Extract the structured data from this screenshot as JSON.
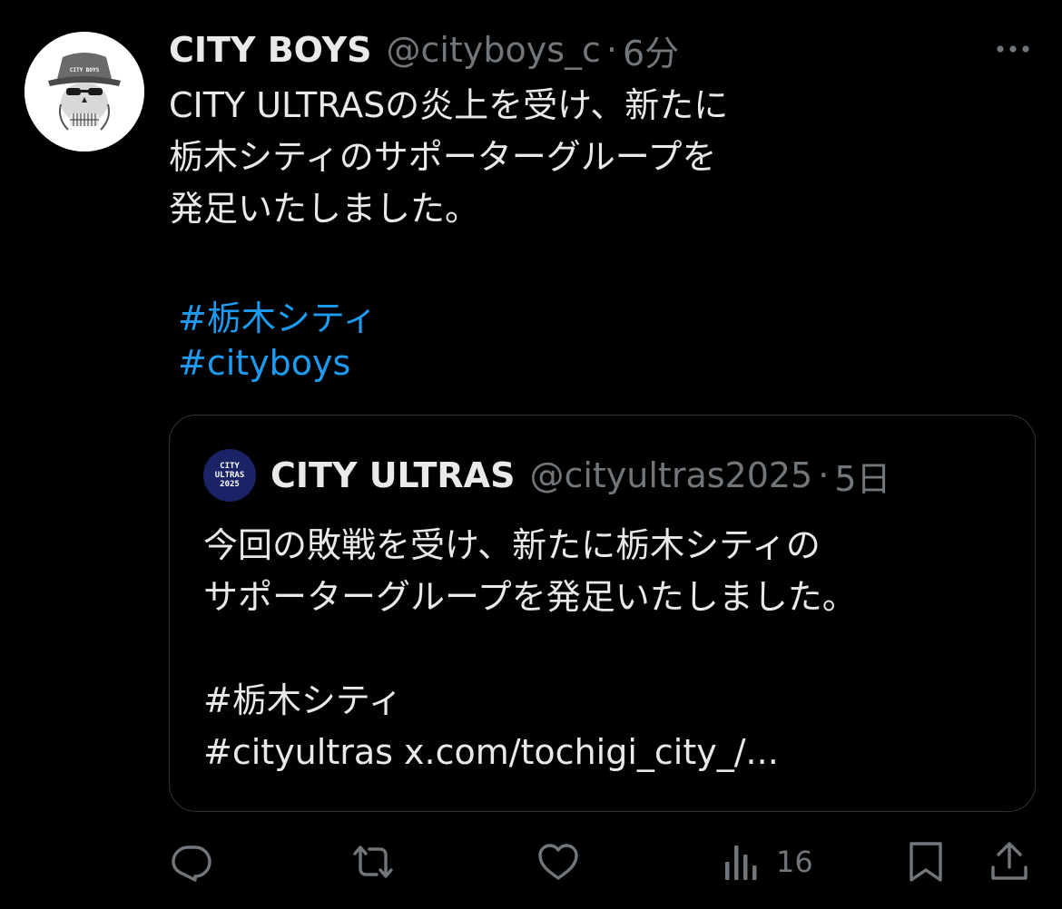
{
  "tweet": {
    "display_name": "CITY BOYS",
    "handle": "@cityboys_c",
    "separator": "·",
    "time": "6分",
    "avatar_text": "CITY BOYS",
    "lines": [
      "CITY ULTRASの炎上を受け、新たに",
      "栃木シティのサポーターグループを",
      "発足いたしました。"
    ],
    "hashtags": [
      "#栃木シティ",
      "#cityboys"
    ]
  },
  "quote": {
    "display_name": "CITY ULTRAS",
    "handle": "@cityultras2025",
    "separator": "·",
    "time": "5日",
    "avatar_lines": [
      "CITY",
      "ULTRAS",
      "2025"
    ],
    "lines": [
      "今回の敗戦を受け、新たに栃木シティの",
      "サポーターグループを発足いたしました。",
      "",
      "#栃木シティ",
      "#cityultras x.com/tochigi_city_/..."
    ]
  },
  "actions": {
    "reply_icon": "reply-icon",
    "repost_icon": "repost-icon",
    "like_icon": "heart-icon",
    "views_icon": "views-icon",
    "views_count": "16",
    "bookmark_icon": "bookmark-icon",
    "share_icon": "share-icon"
  },
  "colors": {
    "background": "#000000",
    "text": "#e7e9ea",
    "muted": "#71767b",
    "link": "#1d9bf0",
    "border": "#2f3336",
    "quote_avatar_bg": "#1a2366"
  }
}
